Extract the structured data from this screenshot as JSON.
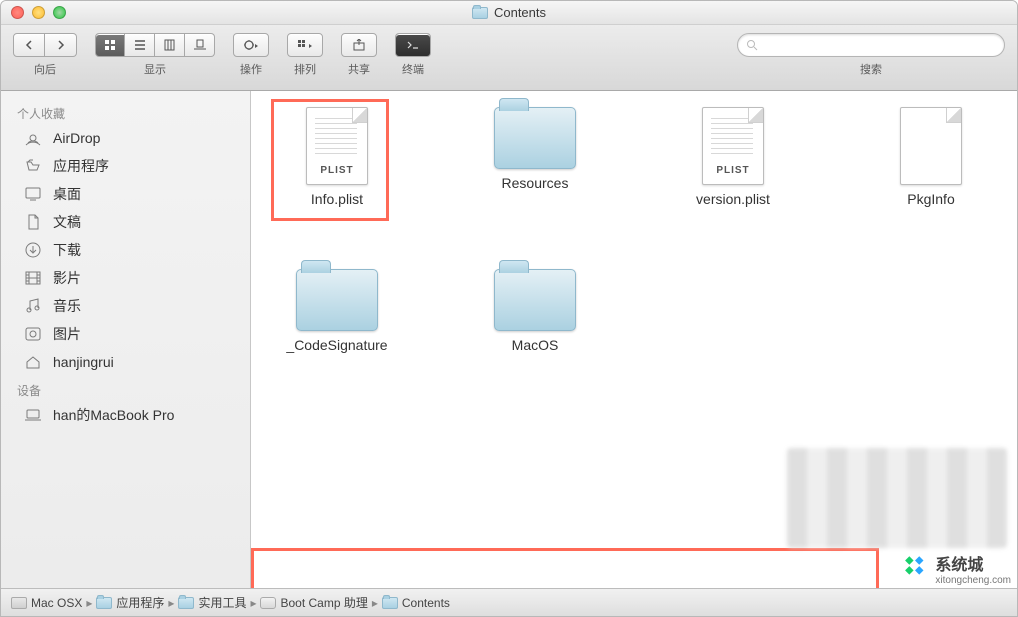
{
  "window": {
    "title": "Contents"
  },
  "toolbar": {
    "nav_label": "向后",
    "view_label": "显示",
    "action_label": "操作",
    "arrange_label": "排列",
    "share_label": "共享",
    "terminal_label": "终端",
    "search_label": "搜索",
    "search_placeholder": ""
  },
  "sidebar": {
    "sections": [
      {
        "header": "个人收藏",
        "items": [
          {
            "icon": "airdrop-icon",
            "label": "AirDrop"
          },
          {
            "icon": "applications-icon",
            "label": "应用程序"
          },
          {
            "icon": "desktop-icon",
            "label": "桌面"
          },
          {
            "icon": "documents-icon",
            "label": "文稿"
          },
          {
            "icon": "downloads-icon",
            "label": "下载"
          },
          {
            "icon": "movies-icon",
            "label": "影片"
          },
          {
            "icon": "music-icon",
            "label": "音乐"
          },
          {
            "icon": "pictures-icon",
            "label": "图片"
          },
          {
            "icon": "home-icon",
            "label": "hanjingrui"
          }
        ]
      },
      {
        "header": "设备",
        "items": [
          {
            "icon": "laptop-icon",
            "label": "han的MacBook Pro"
          }
        ]
      }
    ]
  },
  "files": [
    {
      "name": "Info.plist",
      "type": "plist",
      "highlighted": true
    },
    {
      "name": "Resources",
      "type": "folder"
    },
    {
      "name": "version.plist",
      "type": "plist"
    },
    {
      "name": "PkgInfo",
      "type": "file"
    },
    {
      "name": "_CodeSignature",
      "type": "folder"
    },
    {
      "name": "MacOS",
      "type": "folder"
    }
  ],
  "pathbar": [
    {
      "icon": "hd",
      "label": "Mac OSX"
    },
    {
      "icon": "folder",
      "label": "应用程序"
    },
    {
      "icon": "folder",
      "label": "实用工具"
    },
    {
      "icon": "app",
      "label": "Boot Camp 助理"
    },
    {
      "icon": "folder",
      "label": "Contents"
    }
  ],
  "watermark": {
    "brand": "系统城",
    "url": "xitongcheng.com"
  }
}
